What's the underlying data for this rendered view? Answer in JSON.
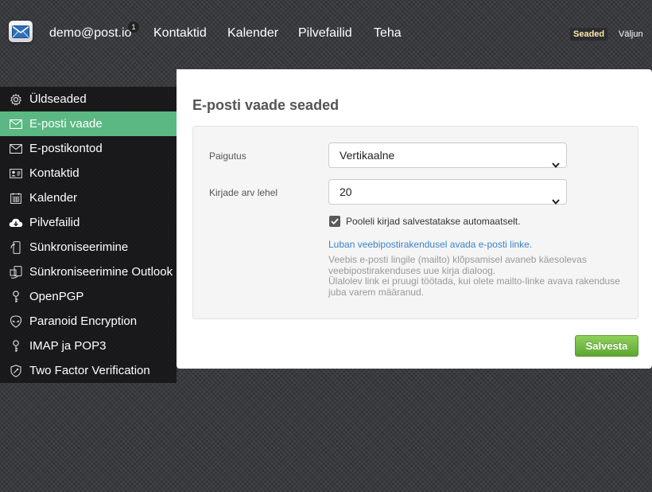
{
  "topbar": {
    "account": "demo@post.io",
    "badge_count": "1",
    "nav": [
      "Kontaktid",
      "Kalender",
      "Pilvefailid",
      "Teha"
    ],
    "settings_label": "Seaded",
    "logout_label": "Väljun"
  },
  "sidebar": {
    "items": [
      {
        "label": "Üldseaded",
        "icon": "gear-icon"
      },
      {
        "label": "E-posti vaade",
        "icon": "envelope-icon",
        "active": true
      },
      {
        "label": "E-postikontod",
        "icon": "envelope-icon"
      },
      {
        "label": "Kontaktid",
        "icon": "contact-card-icon"
      },
      {
        "label": "Kalender",
        "icon": "calendar-icon"
      },
      {
        "label": "Pilvefailid",
        "icon": "cloud-download-icon"
      },
      {
        "label": "Sünkroniseerimine",
        "icon": "sync-phone-icon"
      },
      {
        "label": "Sünkroniseerimine Outlook",
        "icon": "sync-outlook-icon"
      },
      {
        "label": "OpenPGP",
        "icon": "key-icon"
      },
      {
        "label": "Paranoid Encryption",
        "icon": "alien-icon"
      },
      {
        "label": "IMAP ja POP3",
        "icon": "key-icon"
      },
      {
        "label": "Two Factor Verification",
        "icon": "shield-icon"
      }
    ]
  },
  "main": {
    "title": "E-posti vaade seaded",
    "layout_label": "Paigutus",
    "layout_value": "Vertikaalne",
    "per_page_label": "Kirjade arv lehel",
    "per_page_value": "20",
    "autosave_label": "Pooleli kirjad salvestatakse automaatselt.",
    "autosave_checked": true,
    "mailto_link": "Luban veebipostirakendusel avada e-posti linke.",
    "help_lines": [
      "Veebis e-posti lingile (mailto) klõpsamisel avaneb käesolevas",
      "veebipostirakenduses uue kirja dialoog.",
      "Ülalolev link ei pruugi töötada, kui olete mailto-linke avava rakenduse",
      "juba varem määranud."
    ],
    "save_label": "Salvesta"
  },
  "colors": {
    "accent_active": "#5bb882",
    "save_button": "#6fb83f",
    "link": "#3a84c8"
  }
}
